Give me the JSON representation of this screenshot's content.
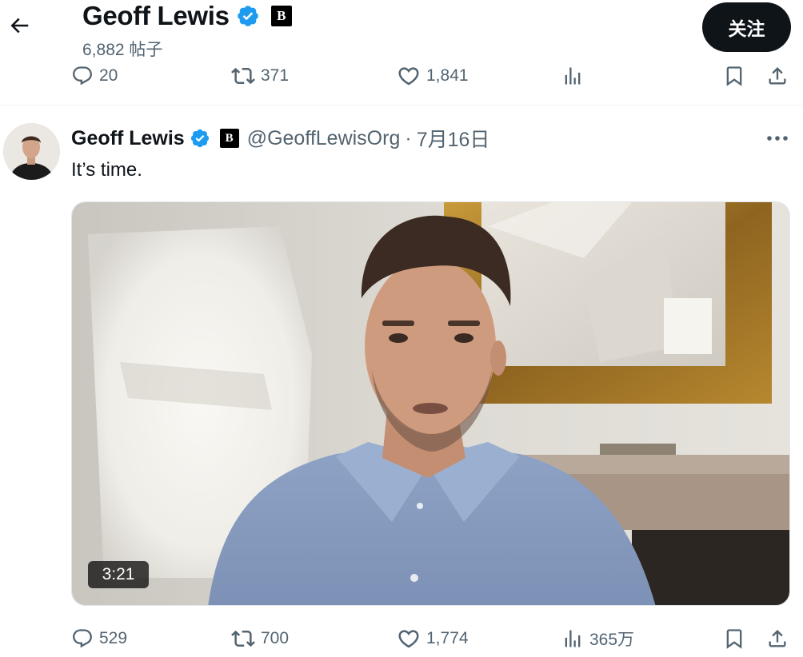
{
  "header": {
    "name": "Geoff Lewis",
    "verified_icon": "verified-badge-icon",
    "affiliate_badge": "B",
    "post_count": "6,882 帖子",
    "follow_label": "关注",
    "back_icon": "arrow-left-icon"
  },
  "top_actions": {
    "replies": "20",
    "reposts": "371",
    "likes": "1,841",
    "views": "",
    "icons": [
      "reply-icon",
      "repost-icon",
      "heart-icon",
      "views-chart-icon",
      "bookmark-icon",
      "share-icon"
    ]
  },
  "tweet": {
    "author_name": "Geoff Lewis",
    "affiliate_badge": "B",
    "handle": "@GeoffLewisOrg",
    "separator": "·",
    "date": "7月16日",
    "text": "It’s time.",
    "video_duration": "3:21"
  },
  "bottom_actions": {
    "replies": "529",
    "reposts": "700",
    "likes": "1,774",
    "views": "365万"
  },
  "colors": {
    "text_primary": "#0f1419",
    "text_secondary": "#536471",
    "verified": "#1d9bf0",
    "follow_bg": "#0f1419",
    "divider": "#eff3f4"
  }
}
